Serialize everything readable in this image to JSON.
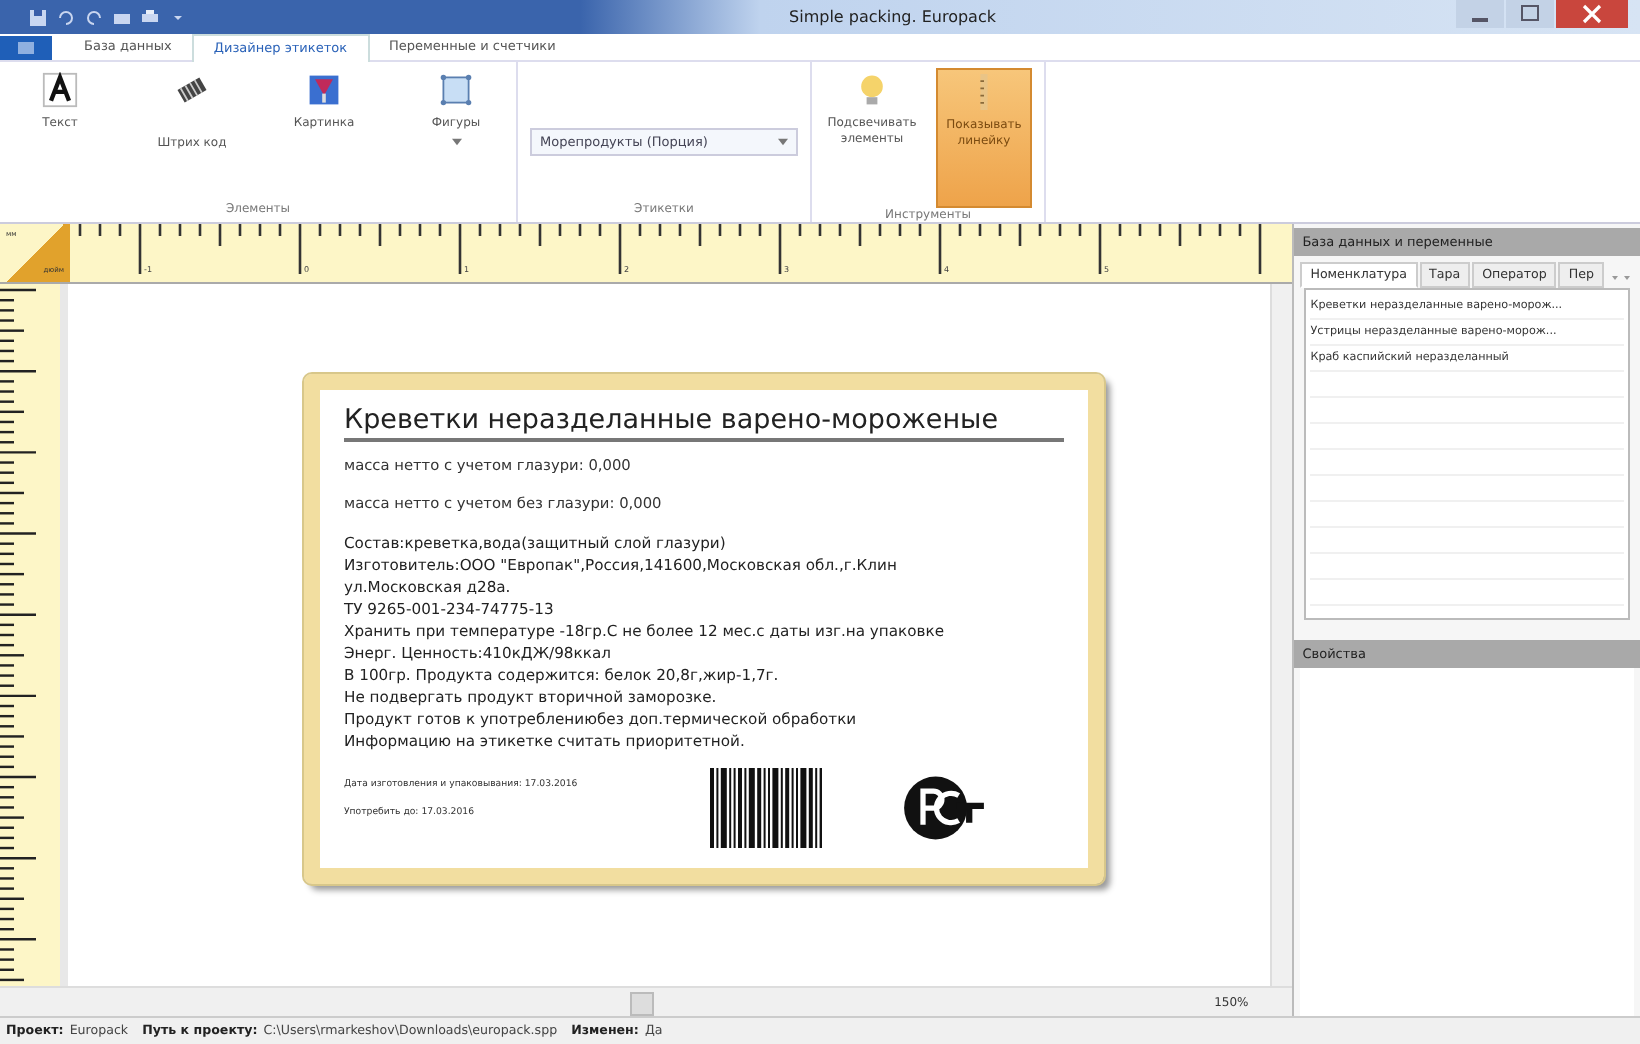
{
  "window": {
    "title": "Simple packing. Europack"
  },
  "ribbon_tabs": [
    {
      "label": "База данных",
      "selected": false
    },
    {
      "label": "Дизайнер этикеток",
      "selected": true
    },
    {
      "label": "Переменные и счетчики",
      "selected": false
    }
  ],
  "ribbon_groups": [
    {
      "title": "Элементы",
      "items": [
        {
          "kind": "text",
          "label": "Текст"
        },
        {
          "kind": "barcode",
          "label": "Штрих код"
        },
        {
          "kind": "image",
          "label": "Картинка"
        },
        {
          "kind": "shapes",
          "label": "Фигуры"
        }
      ]
    },
    {
      "title": "Этикетки",
      "items": [
        {
          "kind": "dropdown",
          "label": "Морепродукты (Порция)"
        }
      ]
    },
    {
      "title": "Инструменты",
      "items": [
        {
          "kind": "bulb",
          "label": "Подсвечивать элементы",
          "selected": false
        },
        {
          "kind": "ruler",
          "label": "Показывать линейку",
          "selected": true
        }
      ]
    }
  ],
  "ruler": {
    "unit_top": "мм",
    "unit_bottom": "дюйм",
    "labels": [
      "-1",
      "0",
      "1",
      "2",
      "3",
      "4",
      "5"
    ]
  },
  "label": {
    "title": "Креветки неразделанные варено-мороженые",
    "weights": [
      "масса нетто с учетом глазури: 0,000",
      "масса нетто с учетом без глазури: 0,000"
    ],
    "lines": [
      "Состав:креветка,вода(защитный слой глазури)",
      "Изготовитель:ООО \"Европак\",Россия,141600,Московская обл.,г.Клин",
      "ул.Московская д28а.",
      "ТУ 9265-001-234-74775-13",
      "Хранить при температуре -18гр.С не более 12 мес.с даты изг.на упаковке",
      "Энерг. Ценность:410кДЖ/98ккал",
      "В 100гр. Продукта содержится: белок 20,8г,жир-1,7г.",
      "Не подвергать продукт вторичной заморозке.",
      "Продукт готов к употреблениюбез доп.термической обработки",
      "Информацию на этикетке считать приоритетной."
    ],
    "dates": [
      "Дата изготовления и упаковывания: 17.03.2016",
      "Употребить до: 17.03.2016"
    ]
  },
  "zoom": "150%",
  "side_panel": {
    "title": "База данных и переменные",
    "tabs": [
      {
        "label": "Номенклатура",
        "selected": true
      },
      {
        "label": "Тара",
        "selected": false
      },
      {
        "label": "Оператор",
        "selected": false
      },
      {
        "label": "Пер",
        "selected": false
      }
    ],
    "items": [
      "Креветки неразделанные варено-морож...",
      "Устрицы неразделанные варено-морож...",
      "Краб каспийский неразделанный"
    ],
    "properties_title": "Свойства"
  },
  "status_bar": [
    {
      "label": "Проект:",
      "value": "Europack"
    },
    {
      "label": "Путь к проекту:",
      "value": "C:\\Users\\rmarkeshov\\Downloads\\europack.spp"
    },
    {
      "label": "Изменен:",
      "value": "Да"
    }
  ]
}
